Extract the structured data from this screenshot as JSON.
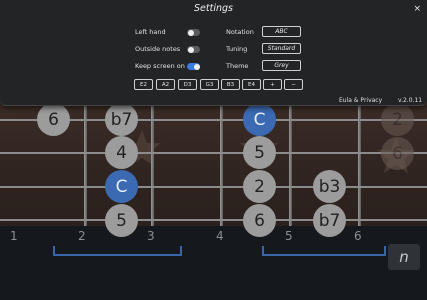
{
  "settings": {
    "title": "Settings",
    "close": "×",
    "left_hand": {
      "label": "Left hand",
      "on": false
    },
    "outside_notes": {
      "label": "Outside notes",
      "on": false
    },
    "keep_screen_on": {
      "label": "Keep screen on",
      "on": true
    },
    "notation": {
      "label": "Notation",
      "value": "ABC"
    },
    "tuning": {
      "label": "Tuning",
      "value": "Standard"
    },
    "theme": {
      "label": "Theme",
      "value": "Grey"
    },
    "tuning_buttons": [
      "E2",
      "A2",
      "D3",
      "G3",
      "B3",
      "E4",
      "+",
      "−"
    ],
    "eula": "Eula & Privacy",
    "version": "v.2.0.11"
  },
  "colors": {
    "root_note": "#3b6ab3",
    "note": "#9c9c9c",
    "toggle_on": "#3b7be0"
  },
  "fretboard": {
    "fret_numbers": [
      "1",
      "2",
      "3",
      "4",
      "5",
      "6"
    ],
    "notes": [
      "6",
      "b7",
      "C",
      "2",
      "4",
      "5",
      "C",
      "2",
      "b3",
      "5",
      "6",
      "b7"
    ],
    "faded_notes": [
      "2",
      "6"
    ],
    "notation_button": "n"
  }
}
